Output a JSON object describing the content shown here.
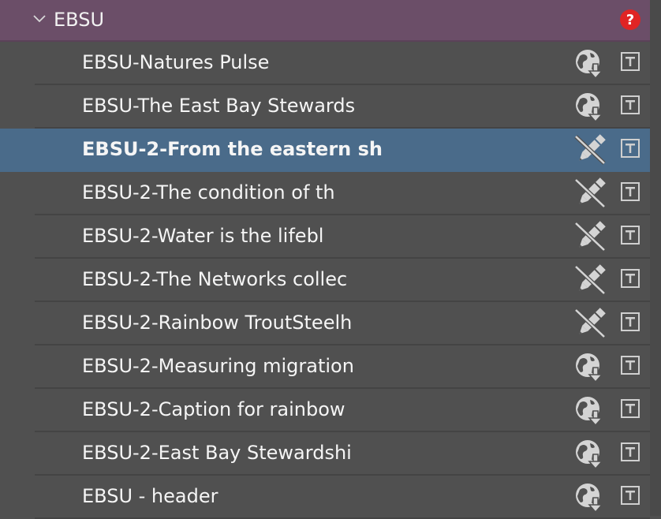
{
  "group": {
    "title": "EBSU",
    "expand_icon": "chevron-down-icon",
    "help_icon": "question-icon",
    "help_color": "#e02424"
  },
  "colors": {
    "header_bg": "#6b4e68",
    "selected_bg": "#4a6b8a",
    "panel_bg": "#505050"
  },
  "rows": [
    {
      "label": "EBSU-Natures Pulse",
      "status_icon": "globe-download-icon",
      "type_icon": "text-icon",
      "selected": false
    },
    {
      "label": "EBSU-The East Bay Stewards",
      "status_icon": "globe-download-icon",
      "type_icon": "text-icon",
      "selected": false
    },
    {
      "label": "EBSU-2-From the eastern sh",
      "status_icon": "pen-disabled-icon",
      "type_icon": "text-icon",
      "selected": true
    },
    {
      "label": "EBSU-2-The condition of th",
      "status_icon": "pen-disabled-icon",
      "type_icon": "text-icon",
      "selected": false
    },
    {
      "label": "EBSU-2-Water is the lifebl",
      "status_icon": "pen-disabled-icon",
      "type_icon": "text-icon",
      "selected": false
    },
    {
      "label": "EBSU-2-The Networks collec",
      "status_icon": "pen-disabled-icon",
      "type_icon": "text-icon",
      "selected": false
    },
    {
      "label": "EBSU-2-Rainbow TroutSteelh",
      "status_icon": "pen-disabled-icon",
      "type_icon": "text-icon",
      "selected": false
    },
    {
      "label": "EBSU-2-Measuring migration",
      "status_icon": "globe-download-icon",
      "type_icon": "text-icon",
      "selected": false
    },
    {
      "label": "EBSU-2-Caption for rainbow",
      "status_icon": "globe-download-icon",
      "type_icon": "text-icon",
      "selected": false
    },
    {
      "label": "EBSU-2-East Bay Stewardshi",
      "status_icon": "globe-download-icon",
      "type_icon": "text-icon",
      "selected": false
    },
    {
      "label": "EBSU - header",
      "status_icon": "globe-download-icon",
      "type_icon": "text-icon",
      "selected": false
    }
  ]
}
